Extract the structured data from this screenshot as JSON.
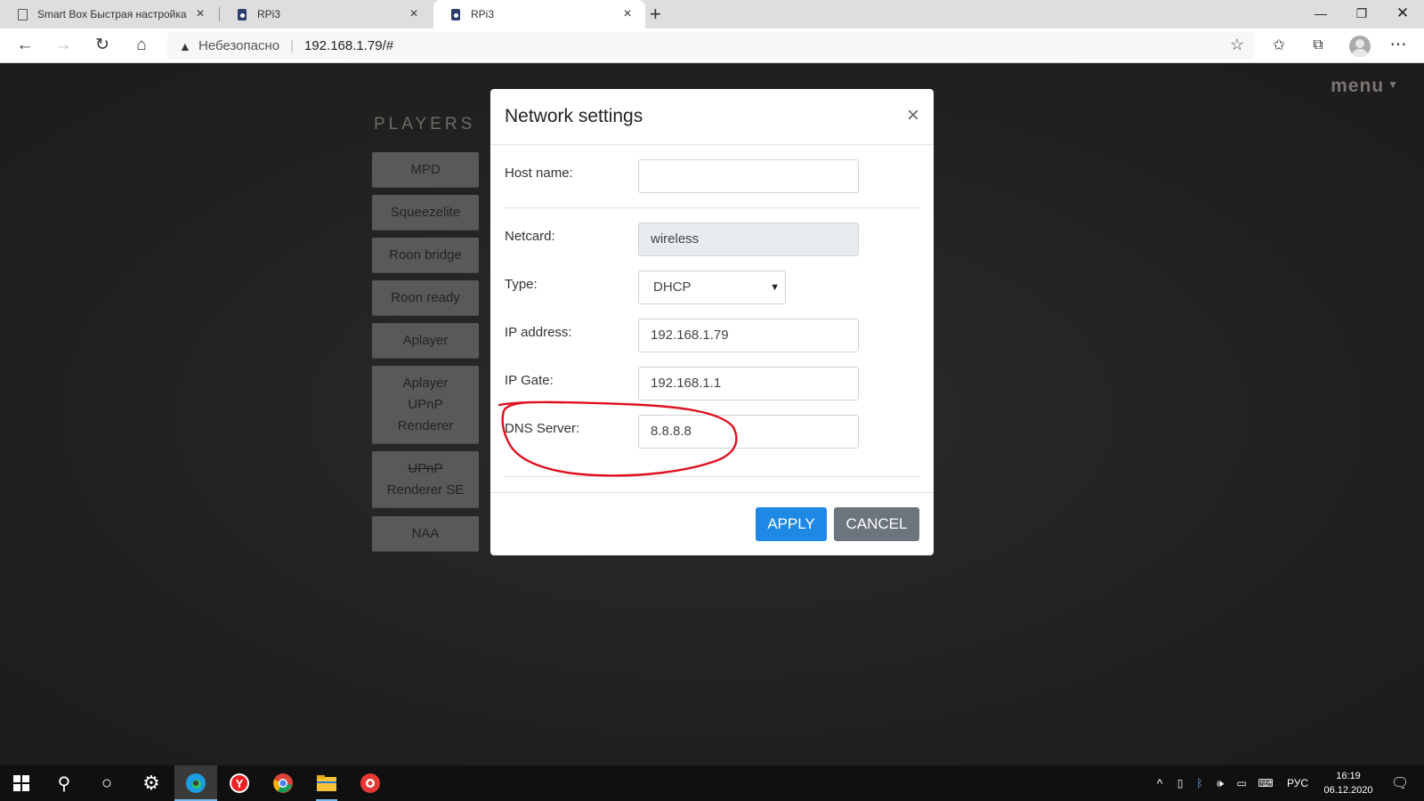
{
  "browser": {
    "tabs": [
      {
        "title": "Smart Box Быстрая настройка",
        "icon": "document-icon",
        "active": false
      },
      {
        "title": "RPi3",
        "icon": "speaker-icon",
        "active": false
      },
      {
        "title": "RPi3",
        "icon": "speaker-icon",
        "active": true
      }
    ],
    "security_label": "Небезопасно",
    "url": "192.168.1.79/#"
  },
  "page": {
    "menu_label": "menu",
    "players_title": "PLAYERS",
    "players": [
      {
        "lines": [
          "MPD"
        ]
      },
      {
        "lines": [
          "Squeezelite"
        ]
      },
      {
        "lines": [
          "Roon bridge"
        ]
      },
      {
        "lines": [
          "Roon ready"
        ]
      },
      {
        "lines": [
          "Aplayer"
        ]
      },
      {
        "lines": [
          "Aplayer",
          "UPnP",
          "Renderer"
        ]
      },
      {
        "lines": [
          "UPnP",
          "Renderer SE"
        ],
        "strike_first": true
      },
      {
        "lines": [
          "NAA"
        ]
      }
    ]
  },
  "modal": {
    "title": "Network settings",
    "close_symbol": "×",
    "host_name_label": "Host name:",
    "host_name_value": "",
    "netcard_label": "Netcard:",
    "netcard_value": "wireless",
    "type_label": "Type:",
    "type_value": "DHCP",
    "ip_label": "IP address:",
    "ip_value": "192.168.1.79",
    "gate_label": "IP Gate:",
    "gate_value": "192.168.1.1",
    "dns_label": "DNS Server:",
    "dns_value": "8.8.8.8",
    "apply_label": "APPLY",
    "cancel_label": "CANCEL"
  },
  "taskbar": {
    "language": "РУС",
    "time": "16:19",
    "date": "06.12.2020"
  },
  "colors": {
    "apply": "#1e88e5",
    "cancel": "#6c757d",
    "annotation": "#e0101e"
  }
}
